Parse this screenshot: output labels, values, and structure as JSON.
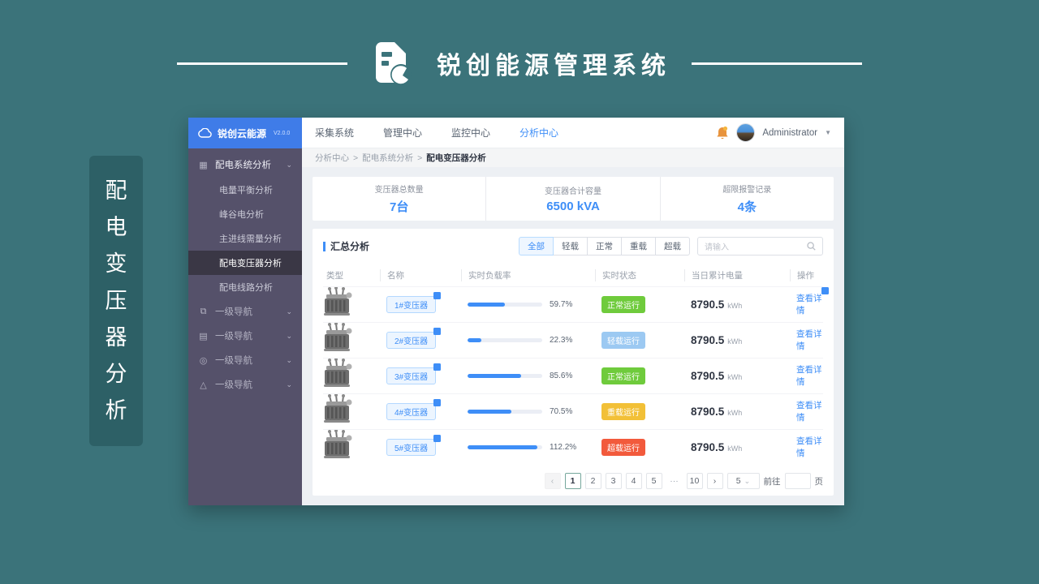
{
  "stage": {
    "header_title": "锐创能源管理系统",
    "side_banner_chars": [
      "配",
      "电",
      "变",
      "压",
      "器",
      "分",
      "析"
    ]
  },
  "app": {
    "logo": {
      "name": "锐创云能源",
      "version": "V2.0.0"
    },
    "topnav": {
      "items": [
        {
          "label": "采集系统"
        },
        {
          "label": "管理中心"
        },
        {
          "label": "监控中心"
        },
        {
          "label": "分析中心"
        }
      ],
      "user_name": "Administrator"
    },
    "breadcrumb": {
      "separator": ">",
      "parts": [
        "分析中心",
        "配电系统分析"
      ],
      "current": "配电变压器分析"
    },
    "sidebar": {
      "group_label": "配电系统分析",
      "sub_items": [
        "电量平衡分析",
        "峰谷电分析",
        "主进线需量分析",
        "配电变压器分析",
        "配电线路分析"
      ],
      "active_sub_item": "配电变压器分析",
      "secondary_items": [
        {
          "label": "一级导航",
          "icon": "external-link-icon"
        },
        {
          "label": "一级导航",
          "icon": "monitor-icon"
        },
        {
          "label": "一级导航",
          "icon": "check-circle-icon"
        },
        {
          "label": "一级导航",
          "icon": "warning-triangle-icon"
        }
      ]
    },
    "stats": [
      {
        "label": "变压器总数量",
        "value": "7台"
      },
      {
        "label": "变压器合计容量",
        "value": "6500 kVA"
      },
      {
        "label": "超限报警记录",
        "value": "4条"
      }
    ],
    "summary": {
      "title": "汇总分析",
      "filters": [
        "全部",
        "轻载",
        "正常",
        "重载",
        "超载"
      ],
      "active_filter": "全部",
      "search_placeholder": "请输入"
    },
    "table": {
      "columns": [
        "类型",
        "名称",
        "实时负载率",
        "实时状态",
        "当日累计电量",
        "操作"
      ],
      "energy_unit": "kWh",
      "action_label": "查看详情",
      "rows": [
        {
          "name": "1#变压器",
          "load_pct": 59.7,
          "load_label": "59.7%",
          "status": "正常运行",
          "status_type": "normal",
          "energy": "8790.5",
          "action_badge": true
        },
        {
          "name": "2#变压器",
          "load_pct": 22.3,
          "load_label": "22.3%",
          "status": "轻载运行",
          "status_type": "light",
          "energy": "8790.5",
          "action_badge": false
        },
        {
          "name": "3#变压器",
          "load_pct": 85.6,
          "load_label": "85.6%",
          "status": "正常运行",
          "status_type": "normal",
          "energy": "8790.5",
          "action_badge": false
        },
        {
          "name": "4#变压器",
          "load_pct": 70.5,
          "load_label": "70.5%",
          "status": "重载运行",
          "status_type": "heavy",
          "energy": "8790.5",
          "action_badge": false
        },
        {
          "name": "5#变压器",
          "load_pct": 112.2,
          "load_label": "112.2%",
          "status": "超载运行",
          "status_type": "over",
          "energy": "8790.5",
          "action_badge": false
        }
      ]
    },
    "pagination": {
      "prev": "‹",
      "next": "›",
      "pages": [
        "1",
        "2",
        "3",
        "4",
        "5",
        "···",
        "10"
      ],
      "active_page": "1",
      "page_size": "5",
      "goto_label": "前往",
      "page_unit_label": "页"
    }
  }
}
